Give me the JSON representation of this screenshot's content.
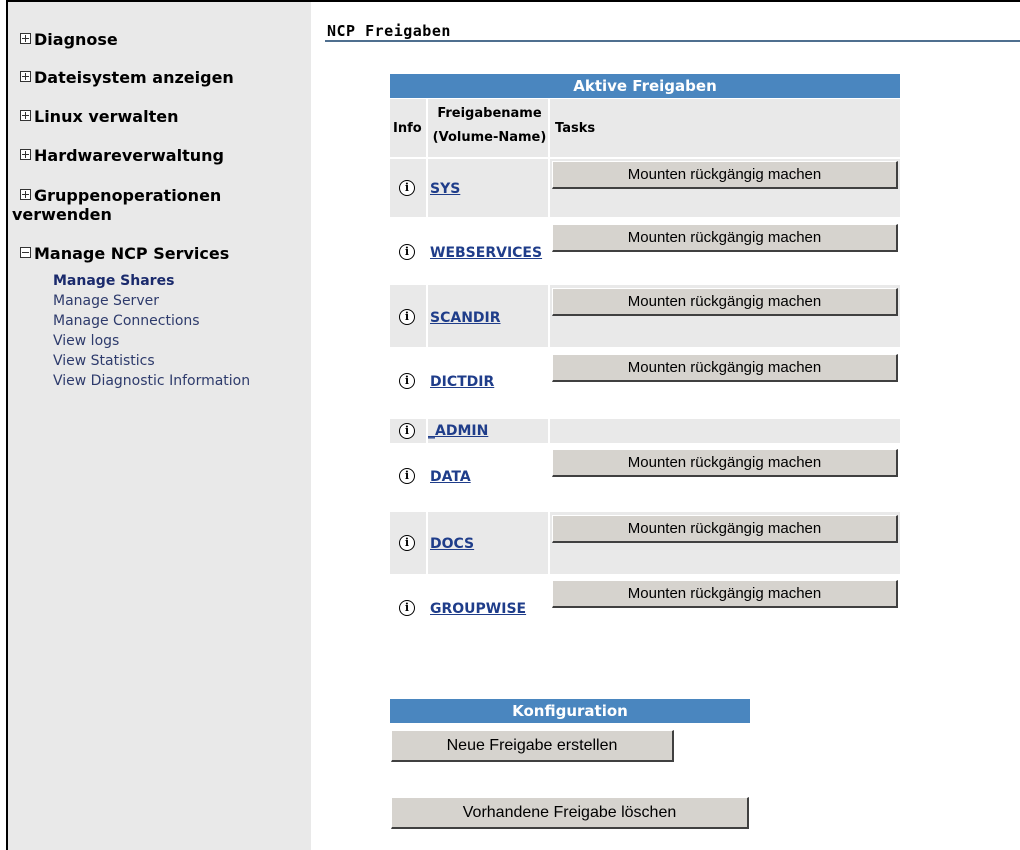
{
  "sidebar": {
    "groups": [
      {
        "label": "Diagnose"
      },
      {
        "label": "Dateisystem anzeigen"
      },
      {
        "label": "Linux verwalten"
      },
      {
        "label": "Hardwareverwaltung"
      },
      {
        "label_line1": "Gruppenoperationen",
        "label_line2": "verwenden"
      },
      {
        "label": "Manage NCP Services"
      }
    ],
    "sub_items": [
      {
        "label": "Manage Shares"
      },
      {
        "label": "Manage Server"
      },
      {
        "label": "Manage Connections"
      },
      {
        "label": "View logs"
      },
      {
        "label": "View Statistics"
      },
      {
        "label": "View Diagnostic Information"
      }
    ]
  },
  "main": {
    "title": "NCP Freigaben",
    "shares_table": {
      "header": "Aktive Freigaben",
      "col_info": "Info",
      "col_name_line1": "Freigabename",
      "col_name_line2": "(Volume-Name)",
      "col_tasks": "Tasks",
      "info_glyph": "i",
      "rows": [
        {
          "name": "SYS",
          "task": "Mounten rückgängig machen"
        },
        {
          "name": "WEBSERVICES",
          "task": "Mounten rückgängig machen"
        },
        {
          "name": "SCANDIR",
          "task": "Mounten rückgängig machen"
        },
        {
          "name": "DICTDIR",
          "task": "Mounten rückgängig machen"
        },
        {
          "name": "_ADMIN",
          "task": ""
        },
        {
          "name": "DATA",
          "task": "Mounten rückgängig machen"
        },
        {
          "name": "DOCS",
          "task": "Mounten rückgängig machen"
        },
        {
          "name": "GROUPWISE",
          "task": "Mounten rückgängig machen"
        }
      ]
    },
    "config": {
      "header": "Konfiguration",
      "create_label": "Neue Freigabe erstellen",
      "delete_label": "Vorhandene Freigabe löschen"
    }
  },
  "colors": {
    "header_blue": "#4a86bf",
    "link_blue": "#1f3d8a",
    "sidebar_bg": "#e9e9e9",
    "button_bg": "#d6d3ce"
  }
}
